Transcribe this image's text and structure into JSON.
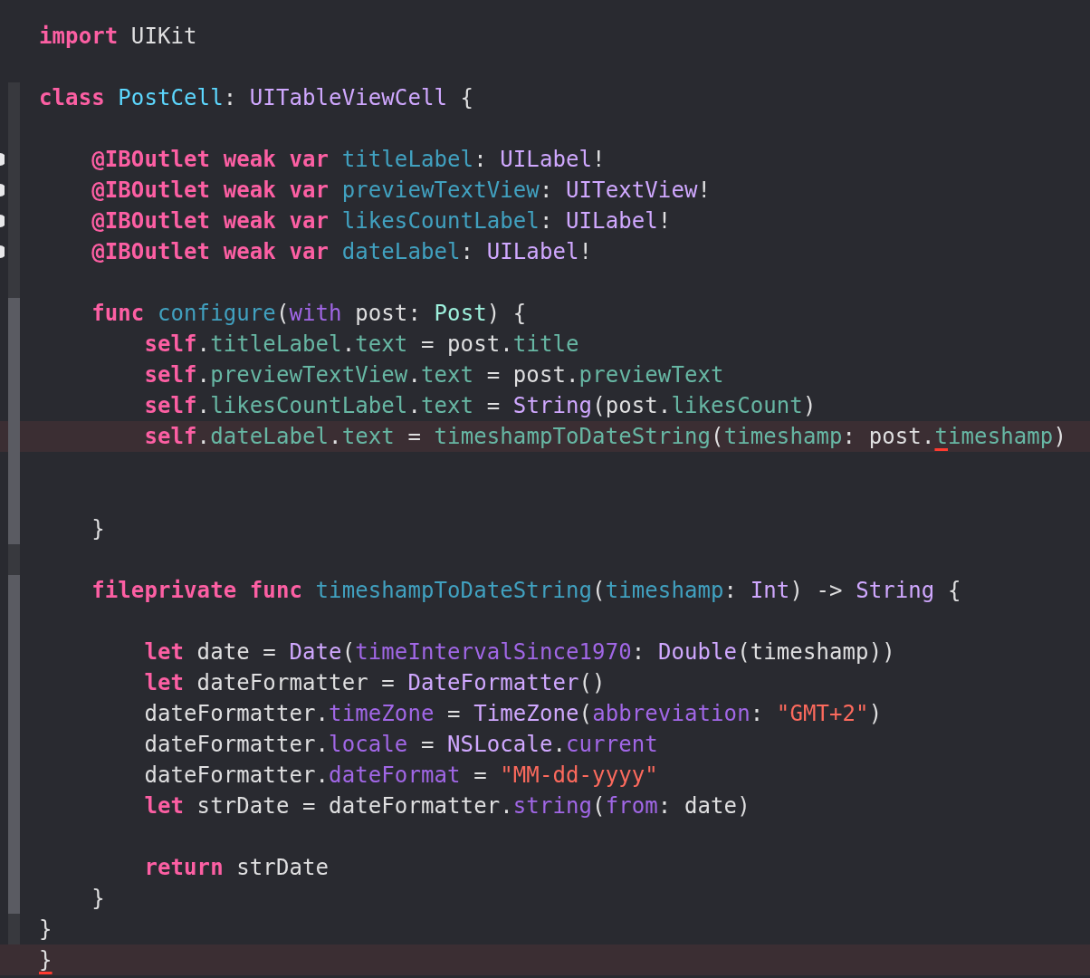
{
  "editor": {
    "lines": [
      {
        "fold_outer": false,
        "tokens": [
          {
            "text": "import",
            "kind": "kw"
          },
          {
            "text": " UIKit",
            "kind": "plain"
          }
        ]
      },
      {
        "fold_outer": false
      },
      {
        "fold_outer": true,
        "fold_inner": false,
        "tokens": [
          {
            "text": "class ",
            "kind": "kw"
          },
          {
            "text": "PostCell",
            "kind": "ptype"
          },
          {
            "text": ": ",
            "kind": "plain"
          },
          {
            "text": "UITableViewCell",
            "kind": "type"
          },
          {
            "text": " {",
            "kind": "plain"
          }
        ]
      },
      {
        "fold_outer": true,
        "fold_inner": false
      },
      {
        "fold_outer": true,
        "fold_inner": false,
        "outlet_connected": true,
        "tokens": [
          {
            "text": "    @IBOutlet weak var ",
            "kind": "kw"
          },
          {
            "text": "titleLabel",
            "kind": "decl"
          },
          {
            "text": ": ",
            "kind": "plain"
          },
          {
            "text": "UILabel",
            "kind": "type"
          },
          {
            "text": "!",
            "kind": "plain"
          }
        ]
      },
      {
        "fold_outer": true,
        "fold_inner": false,
        "outlet_connected": true,
        "tokens": [
          {
            "text": "    @IBOutlet weak var ",
            "kind": "kw"
          },
          {
            "text": "previewTextView",
            "kind": "decl"
          },
          {
            "text": ": ",
            "kind": "plain"
          },
          {
            "text": "UITextView",
            "kind": "type"
          },
          {
            "text": "!",
            "kind": "plain"
          }
        ]
      },
      {
        "fold_outer": true,
        "fold_inner": false,
        "outlet_connected": true,
        "tokens": [
          {
            "text": "    @IBOutlet weak var ",
            "kind": "kw"
          },
          {
            "text": "likesCountLabel",
            "kind": "decl"
          },
          {
            "text": ": ",
            "kind": "plain"
          },
          {
            "text": "UILabel",
            "kind": "type"
          },
          {
            "text": "!",
            "kind": "plain"
          }
        ]
      },
      {
        "fold_outer": true,
        "fold_inner": false,
        "outlet_connected": true,
        "tokens": [
          {
            "text": "    @IBOutlet weak var ",
            "kind": "kw"
          },
          {
            "text": "dateLabel",
            "kind": "decl"
          },
          {
            "text": ": ",
            "kind": "plain"
          },
          {
            "text": "UILabel",
            "kind": "type"
          },
          {
            "text": "!",
            "kind": "plain"
          }
        ]
      },
      {
        "fold_outer": true,
        "fold_inner": false
      },
      {
        "fold_outer": true,
        "fold_inner": true,
        "tokens": [
          {
            "text": "    func ",
            "kind": "kw"
          },
          {
            "text": "configure",
            "kind": "decl"
          },
          {
            "text": "(",
            "kind": "plain"
          },
          {
            "text": "with",
            "kind": "sysmember"
          },
          {
            "text": " post: ",
            "kind": "plain"
          },
          {
            "text": "Post",
            "kind": "ptypeuse"
          },
          {
            "text": ") {",
            "kind": "plain"
          }
        ]
      },
      {
        "fold_outer": true,
        "fold_inner": true,
        "tokens": [
          {
            "text": "        self",
            "kind": "kw"
          },
          {
            "text": ".",
            "kind": "plain"
          },
          {
            "text": "titleLabel",
            "kind": "member"
          },
          {
            "text": ".",
            "kind": "plain"
          },
          {
            "text": "text",
            "kind": "member"
          },
          {
            "text": " = post.",
            "kind": "plain"
          },
          {
            "text": "title",
            "kind": "member"
          }
        ]
      },
      {
        "fold_outer": true,
        "fold_inner": true,
        "tokens": [
          {
            "text": "        self",
            "kind": "kw"
          },
          {
            "text": ".",
            "kind": "plain"
          },
          {
            "text": "previewTextView",
            "kind": "member"
          },
          {
            "text": ".",
            "kind": "plain"
          },
          {
            "text": "text",
            "kind": "member"
          },
          {
            "text": " = post.",
            "kind": "plain"
          },
          {
            "text": "previewText",
            "kind": "member"
          }
        ]
      },
      {
        "fold_outer": true,
        "fold_inner": true,
        "tokens": [
          {
            "text": "        self",
            "kind": "kw"
          },
          {
            "text": ".",
            "kind": "plain"
          },
          {
            "text": "likesCountLabel",
            "kind": "member"
          },
          {
            "text": ".",
            "kind": "plain"
          },
          {
            "text": "text",
            "kind": "member"
          },
          {
            "text": " = ",
            "kind": "plain"
          },
          {
            "text": "String",
            "kind": "type"
          },
          {
            "text": "(post.",
            "kind": "plain"
          },
          {
            "text": "likesCount",
            "kind": "member"
          },
          {
            "text": ")",
            "kind": "plain"
          }
        ]
      },
      {
        "fold_outer": true,
        "fold_inner": true,
        "error": true,
        "tokens": [
          {
            "text": "        self",
            "kind": "kw"
          },
          {
            "text": ".",
            "kind": "plain"
          },
          {
            "text": "dateLabel",
            "kind": "member"
          },
          {
            "text": ".",
            "kind": "plain"
          },
          {
            "text": "text",
            "kind": "member"
          },
          {
            "text": " = ",
            "kind": "plain"
          },
          {
            "text": "timeshampToDateString",
            "kind": "member"
          },
          {
            "text": "(",
            "kind": "plain"
          },
          {
            "text": "timeshamp",
            "kind": "member"
          },
          {
            "text": ": post.",
            "kind": "plain"
          },
          {
            "text": "t",
            "kind": "member",
            "error": true
          },
          {
            "text": "imeshamp",
            "kind": "member"
          },
          {
            "text": ")",
            "kind": "plain"
          }
        ]
      },
      {
        "fold_outer": true,
        "fold_inner": true
      },
      {
        "fold_outer": true,
        "fold_inner": true
      },
      {
        "fold_outer": true,
        "fold_inner": true,
        "tokens": [
          {
            "text": "    }",
            "kind": "plain"
          }
        ]
      },
      {
        "fold_outer": true,
        "fold_inner": false
      },
      {
        "fold_outer": true,
        "fold_inner": true,
        "tokens": [
          {
            "text": "    fileprivate func ",
            "kind": "kw"
          },
          {
            "text": "timeshampToDateString",
            "kind": "decl"
          },
          {
            "text": "(",
            "kind": "plain"
          },
          {
            "text": "timeshamp",
            "kind": "decl"
          },
          {
            "text": ": ",
            "kind": "plain"
          },
          {
            "text": "Int",
            "kind": "type"
          },
          {
            "text": ") -> ",
            "kind": "plain"
          },
          {
            "text": "String",
            "kind": "type"
          },
          {
            "text": " {",
            "kind": "plain"
          }
        ]
      },
      {
        "fold_outer": true,
        "fold_inner": true
      },
      {
        "fold_outer": true,
        "fold_inner": true,
        "tokens": [
          {
            "text": "        let",
            "kind": "kw"
          },
          {
            "text": " date = ",
            "kind": "plain"
          },
          {
            "text": "Date",
            "kind": "type"
          },
          {
            "text": "(",
            "kind": "plain"
          },
          {
            "text": "timeIntervalSince1970",
            "kind": "sysmember"
          },
          {
            "text": ": ",
            "kind": "plain"
          },
          {
            "text": "Double",
            "kind": "type"
          },
          {
            "text": "(timeshamp))",
            "kind": "plain"
          }
        ]
      },
      {
        "fold_outer": true,
        "fold_inner": true,
        "tokens": [
          {
            "text": "        let",
            "kind": "kw"
          },
          {
            "text": " dateFormatter = ",
            "kind": "plain"
          },
          {
            "text": "DateFormatter",
            "kind": "type"
          },
          {
            "text": "()",
            "kind": "plain"
          }
        ]
      },
      {
        "fold_outer": true,
        "fold_inner": true,
        "tokens": [
          {
            "text": "        dateFormatter.",
            "kind": "plain"
          },
          {
            "text": "timeZone",
            "kind": "sysmember"
          },
          {
            "text": " = ",
            "kind": "plain"
          },
          {
            "text": "TimeZone",
            "kind": "type"
          },
          {
            "text": "(",
            "kind": "plain"
          },
          {
            "text": "abbreviation",
            "kind": "sysmember"
          },
          {
            "text": ": ",
            "kind": "plain"
          },
          {
            "text": "\"GMT+2\"",
            "kind": "str"
          },
          {
            "text": ")",
            "kind": "plain"
          }
        ]
      },
      {
        "fold_outer": true,
        "fold_inner": true,
        "tokens": [
          {
            "text": "        dateFormatter.",
            "kind": "plain"
          },
          {
            "text": "locale",
            "kind": "sysmember"
          },
          {
            "text": " = ",
            "kind": "plain"
          },
          {
            "text": "NSLocale",
            "kind": "type"
          },
          {
            "text": ".",
            "kind": "plain"
          },
          {
            "text": "current",
            "kind": "sysmember"
          }
        ]
      },
      {
        "fold_outer": true,
        "fold_inner": true,
        "tokens": [
          {
            "text": "        dateFormatter.",
            "kind": "plain"
          },
          {
            "text": "dateFormat",
            "kind": "sysmember"
          },
          {
            "text": " = ",
            "kind": "plain"
          },
          {
            "text": "\"MM-dd-yyyy\"",
            "kind": "str"
          }
        ]
      },
      {
        "fold_outer": true,
        "fold_inner": true,
        "tokens": [
          {
            "text": "        let",
            "kind": "kw"
          },
          {
            "text": " strDate = dateFormatter.",
            "kind": "plain"
          },
          {
            "text": "string",
            "kind": "sysmember"
          },
          {
            "text": "(",
            "kind": "plain"
          },
          {
            "text": "from",
            "kind": "sysmember"
          },
          {
            "text": ": date)",
            "kind": "plain"
          }
        ]
      },
      {
        "fold_outer": true,
        "fold_inner": true
      },
      {
        "fold_outer": true,
        "fold_inner": true,
        "tokens": [
          {
            "text": "        return",
            "kind": "kw"
          },
          {
            "text": " strDate",
            "kind": "plain"
          }
        ]
      },
      {
        "fold_outer": true,
        "fold_inner": true,
        "tokens": [
          {
            "text": "    }",
            "kind": "plain"
          }
        ]
      },
      {
        "fold_outer": true,
        "fold_inner": false,
        "tokens": [
          {
            "text": "}",
            "kind": "plain"
          }
        ]
      },
      {
        "fold_outer": false,
        "error": true,
        "tokens": [
          {
            "text": "}",
            "kind": "plain",
            "error": true
          }
        ]
      }
    ]
  }
}
